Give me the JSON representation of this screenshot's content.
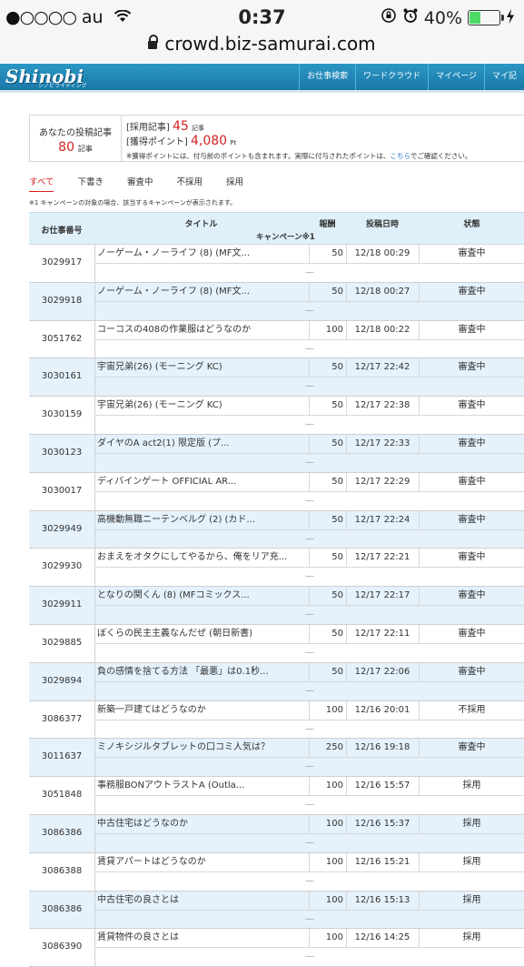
{
  "status_bar": {
    "signal": "●○○○○",
    "carrier": "au",
    "wifi_icon": "wifi-icon",
    "time": "0:37",
    "orientation_icon": "orientation-lock-icon",
    "alarm_icon": "alarm-icon",
    "battery_percent": "40%",
    "battery_level": 0.4,
    "charging_icon": "charging-icon"
  },
  "browser": {
    "url": "crowd.biz-samurai.com"
  },
  "header": {
    "logo": "Shinobi",
    "logo_sub": "シノビライティング",
    "nav": [
      "お仕事検索",
      "ワードクラウド",
      "マイページ",
      "マイ記"
    ]
  },
  "summary": {
    "title": "あなたの投稿記事",
    "count": "80",
    "count_unit": "記事",
    "adopted_label": "[採用記事]",
    "adopted_count": "45",
    "adopted_unit": "記事",
    "points_label": "[獲得ポイント]",
    "points": "4,080",
    "points_unit": "Pt",
    "note": "※獲得ポイントには、付与前のポイントも含まれます。実際に付与されたポイントは、",
    "note_link": "こちら",
    "note_tail": "でご確認ください。"
  },
  "tabs": [
    "すべて",
    "下書き",
    "審査中",
    "不採用",
    "採用"
  ],
  "footnote": "※1 キャンペーンの対象の場合、該当するキャンペーンが表示されます。",
  "table": {
    "headers": {
      "id": "お仕事番号",
      "title": "タイトル",
      "reward": "報酬",
      "date": "投稿日時",
      "status": "状態",
      "campaign": "キャンペーン※1"
    },
    "rows": [
      {
        "id": "3029917",
        "title": "ノーゲーム・ノーライフ (8) (MF文...",
        "reward": "50",
        "date": "12/18 00:29",
        "status": "審査中",
        "campaign": "—"
      },
      {
        "id": "3029918",
        "title": "ノーゲーム・ノーライフ (8) (MF文...",
        "reward": "50",
        "date": "12/18 00:27",
        "status": "審査中",
        "campaign": "—"
      },
      {
        "id": "3051762",
        "title": "コーコスの408の作業服はどうなのか",
        "reward": "100",
        "date": "12/18 00:22",
        "status": "審査中",
        "campaign": "—"
      },
      {
        "id": "3030161",
        "title": "宇宙兄弟(26) (モーニング KC)",
        "reward": "50",
        "date": "12/17 22:42",
        "status": "審査中",
        "campaign": "—"
      },
      {
        "id": "3030159",
        "title": "宇宙兄弟(26) (モーニング KC)",
        "reward": "50",
        "date": "12/17 22:38",
        "status": "審査中",
        "campaign": "—"
      },
      {
        "id": "3030123",
        "title": "ダイヤのA act2(1) 限定版 (プ...",
        "reward": "50",
        "date": "12/17 22:33",
        "status": "審査中",
        "campaign": "—"
      },
      {
        "id": "3030017",
        "title": "ディバインゲート OFFICIAL AR...",
        "reward": "50",
        "date": "12/17 22:29",
        "status": "審査中",
        "campaign": "—"
      },
      {
        "id": "3029949",
        "title": "高機動無職ニーテンベルグ (2) (カド...",
        "reward": "50",
        "date": "12/17 22:24",
        "status": "審査中",
        "campaign": "—"
      },
      {
        "id": "3029930",
        "title": "おまえをオタクにしてやるから、俺をリア充...",
        "reward": "50",
        "date": "12/17 22:21",
        "status": "審査中",
        "campaign": "—"
      },
      {
        "id": "3029911",
        "title": "となりの関くん (8) (MFコミックス...",
        "reward": "50",
        "date": "12/17 22:17",
        "status": "審査中",
        "campaign": "—"
      },
      {
        "id": "3029885",
        "title": "ぼくらの民主主義なんだぜ (朝日新書)",
        "reward": "50",
        "date": "12/17 22:11",
        "status": "審査中",
        "campaign": "—"
      },
      {
        "id": "3029894",
        "title": "負の感情を捨てる方法 「最悪」は0.1秒...",
        "reward": "50",
        "date": "12/17 22:06",
        "status": "審査中",
        "campaign": "—"
      },
      {
        "id": "3086377",
        "title": "新築一戸建てはどうなのか",
        "reward": "100",
        "date": "12/16 20:01",
        "status": "不採用",
        "campaign": "—"
      },
      {
        "id": "3011637",
        "title": "ミノキシジルタブレットの口コミ人気は？",
        "reward": "250",
        "date": "12/16 19:18",
        "status": "審査中",
        "campaign": "—"
      },
      {
        "id": "3051848",
        "title": "事務服BONアウトラストA (Outla...",
        "reward": "100",
        "date": "12/16 15:57",
        "status": "採用",
        "campaign": "—"
      },
      {
        "id": "3086386",
        "title": "中古住宅はどうなのか",
        "reward": "100",
        "date": "12/16 15:37",
        "status": "採用",
        "campaign": "—"
      },
      {
        "id": "3086388",
        "title": "賃貸アパートはどうなのか",
        "reward": "100",
        "date": "12/16 15:21",
        "status": "採用",
        "campaign": "—"
      },
      {
        "id": "3086386",
        "title": "中古住宅の良さとは",
        "reward": "100",
        "date": "12/16 15:13",
        "status": "採用",
        "campaign": "—"
      },
      {
        "id": "3086390",
        "title": "賃貸物件の良さとは",
        "reward": "100",
        "date": "12/16 14:25",
        "status": "採用",
        "campaign": "—"
      }
    ]
  }
}
